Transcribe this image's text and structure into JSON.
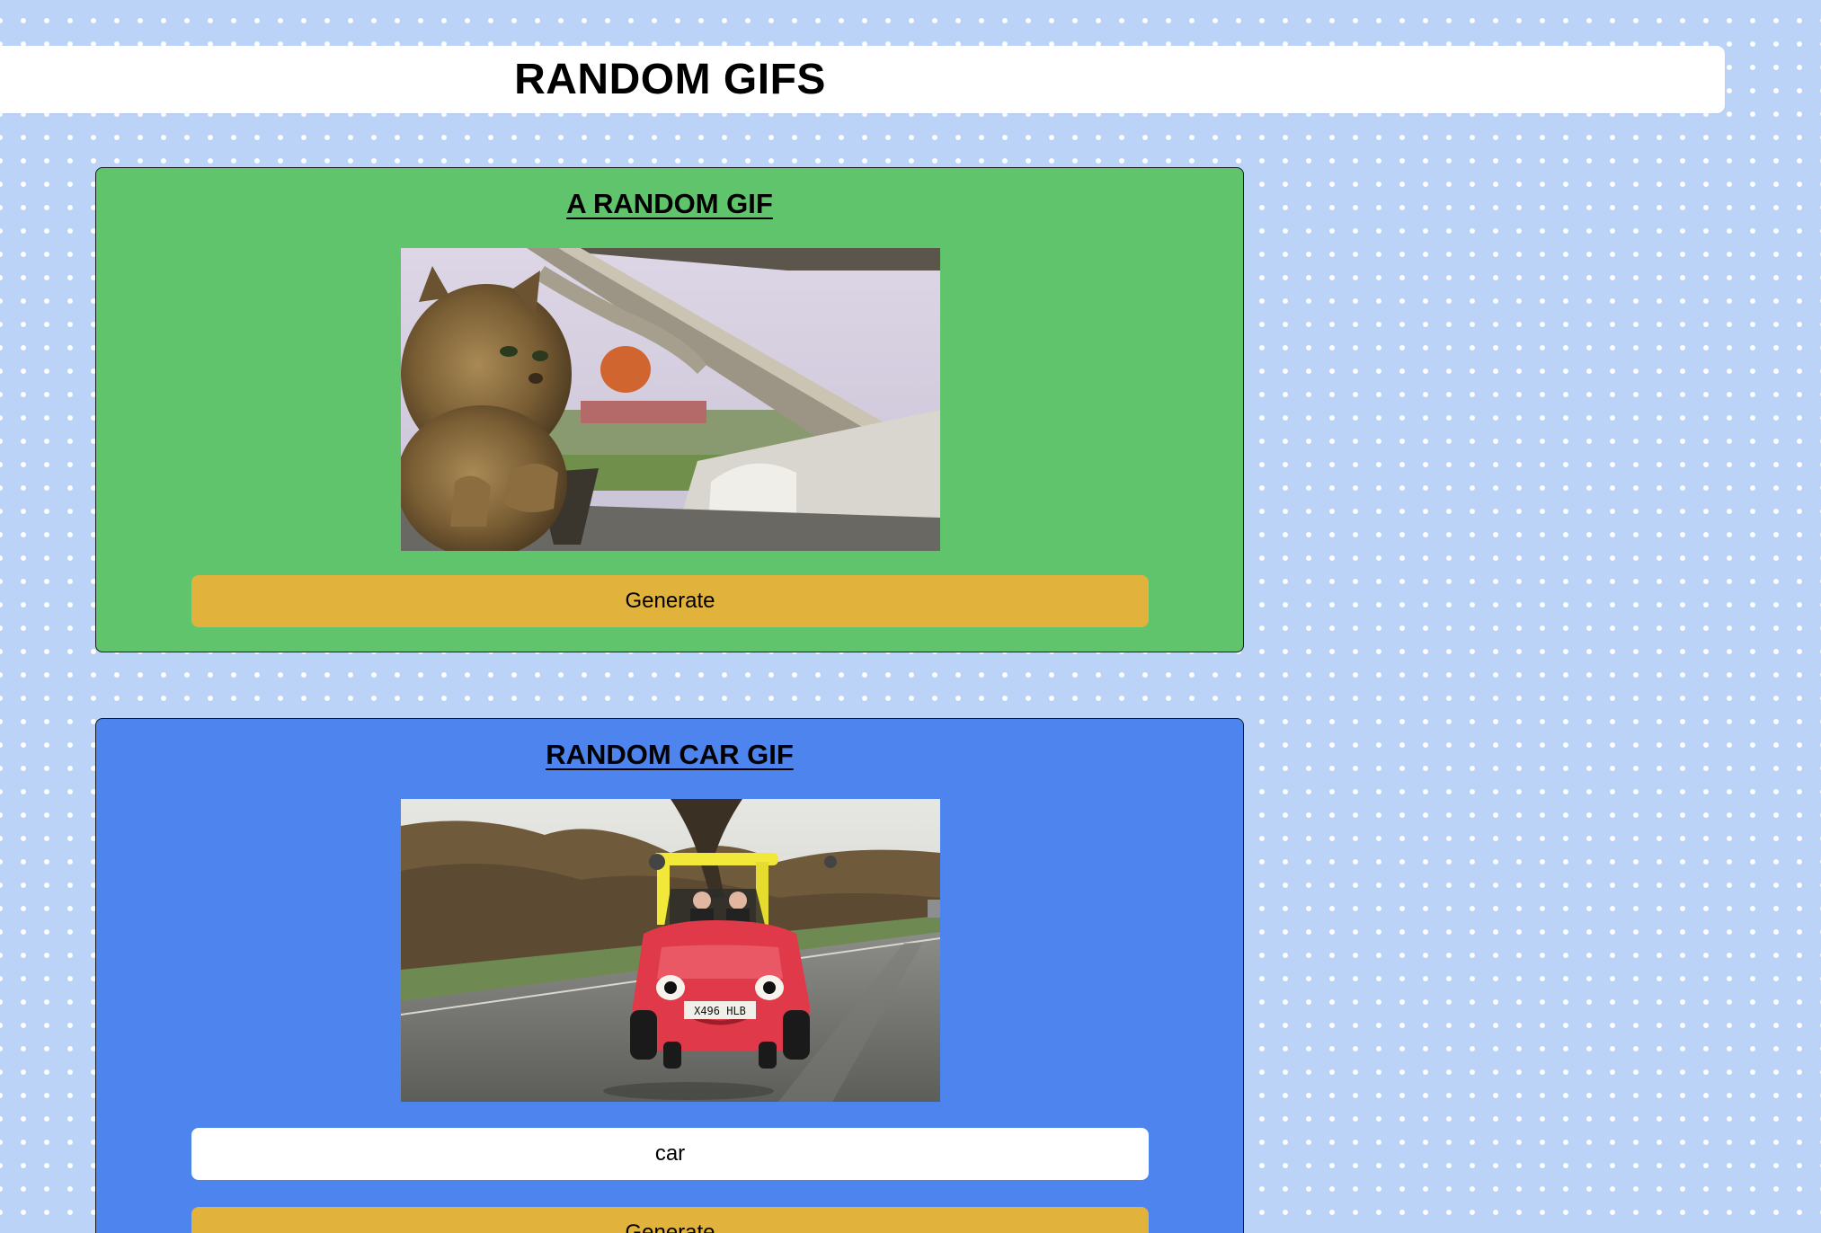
{
  "header": {
    "title": "RANDOM GIFS"
  },
  "random_card": {
    "title": "A RANDOM GIF",
    "generate_label": "Generate",
    "gif_icon": "cat-driving-gif"
  },
  "car_card": {
    "title": "RANDOM CAR GIF",
    "search_value": "car",
    "generate_label": "Generate",
    "gif_icon": "red-toy-car-gif",
    "plate_text": "X496 HLB"
  },
  "colors": {
    "page_background": "#bcd3f8",
    "random_card_background": "#5fc46c",
    "car_card_background": "#4d84ee",
    "button_background": "#e1b23c"
  }
}
